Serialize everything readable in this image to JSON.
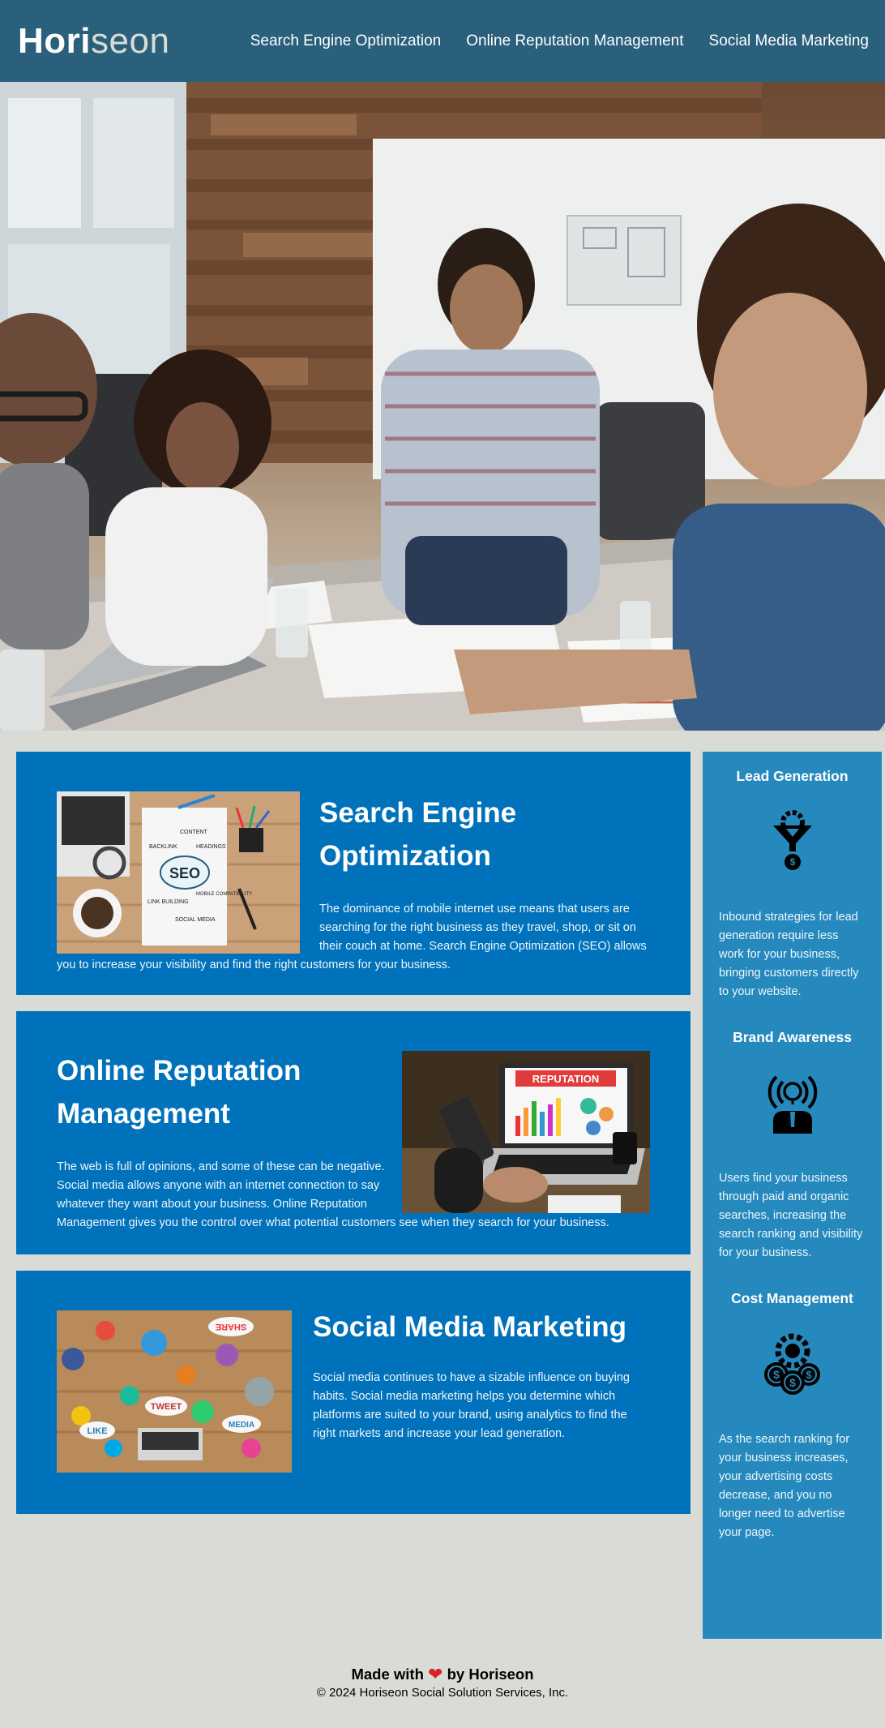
{
  "header": {
    "logo_main": "Hori",
    "logo_accent": "seon",
    "nav": [
      {
        "label": "Search Engine Optimization"
      },
      {
        "label": "Online Reputation Management"
      },
      {
        "label": "Social Media Marketing"
      }
    ]
  },
  "hero": {
    "image_alt": "a group of people working together at a table"
  },
  "content": {
    "seo": {
      "title": "Search Engine Optimization",
      "text": "The dominance of mobile internet use means that users are searching for the right business as they travel, shop, or sit on their couch at home. Search Engine Optimization (SEO) allows you to increase your visibility and find the right customers for your business.",
      "image_words": [
        "SEO",
        "BACKLINK",
        "CONTENT",
        "HEADINGS",
        "LINK BUILDING",
        "MOBILE COMPATIBILITY",
        "SOCIAL MEDIA"
      ]
    },
    "orm": {
      "title": "Online Reputation Management",
      "text": "The web is full of opinions, and some of these can be negative. Social media allows anyone with an internet connection to say whatever they want about your business. Online Reputation Management gives you the control over what potential customers see when they search for your business.",
      "image_words": [
        "REPUTATION"
      ]
    },
    "smm": {
      "title": "Social Media Marketing",
      "text": "Social media continues to have a sizable influence on buying habits. Social media marketing helps you determine which platforms are suited to your brand, using analytics to find the right markets and increase your lead generation.",
      "image_words": [
        "SHARE",
        "TWEET",
        "LIKE",
        "MEDIA"
      ]
    }
  },
  "sidebar": {
    "lead": {
      "title": "Lead Generation",
      "icon": "funnel-gear-dollar-icon",
      "text": "Inbound strategies for lead generation require less work for your business, bringing customers directly to your website."
    },
    "brand": {
      "title": "Brand Awareness",
      "icon": "broadcasting-person-icon",
      "text": "Users find your business through paid and organic searches, increasing the search ranking and visibility for your business."
    },
    "cost": {
      "title": "Cost Management",
      "icon": "gear-coins-icon",
      "text": "As the search ranking for your business increases, your advertising costs decrease, and you no longer need to advertise your page."
    }
  },
  "footer": {
    "made_with": "Made with",
    "by": "by Horiseon",
    "copyright": "© 2024 Horiseon Social Solution Services, Inc."
  },
  "colors": {
    "header_bg": "#2a607c",
    "card_bg": "#0072bb",
    "sidebar_bg": "#2589bd",
    "page_bg": "#d9dcd6",
    "heart": "#d8232a"
  }
}
